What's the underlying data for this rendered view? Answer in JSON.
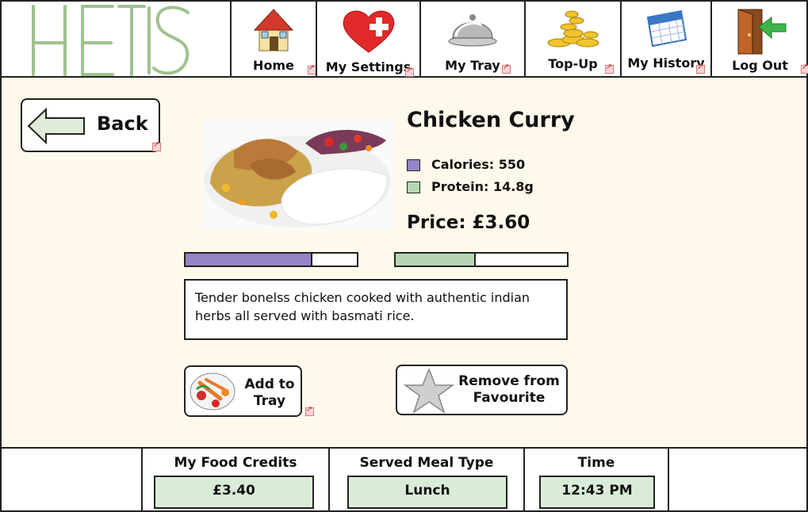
{
  "header": {
    "logo_text": "HEIS",
    "nav": [
      {
        "label": "Home",
        "icon": "house-icon"
      },
      {
        "label": "My Settings",
        "icon": "heart-cross-icon"
      },
      {
        "label": "My Tray",
        "icon": "cloche-icon"
      },
      {
        "label": "Top-Up",
        "icon": "coins-icon"
      },
      {
        "label": "My History",
        "icon": "calendar-icon"
      },
      {
        "label": "Log Out",
        "icon": "door-exit-icon"
      }
    ]
  },
  "main": {
    "back_label": "Back",
    "dish": {
      "title": "Chicken Curry",
      "calories_label": "Calories: 550",
      "protein_label": "Protein: 14.8g",
      "price_label": "Price: £3.60",
      "calories_fraction": 0.73,
      "protein_fraction": 0.46,
      "description": "Tender bonelss chicken cooked with authentic indian herbs all served with basmati rice."
    },
    "add_button": "Add to Tray",
    "favourite_button": "Remove from Favourite",
    "colors": {
      "calories": "#9584c8",
      "protein": "#b5d6b0",
      "background": "#fef9ea"
    }
  },
  "footer": {
    "credits_label": "My Food Credits",
    "credits_value": "£3.40",
    "meal_label": "Served Meal Type",
    "meal_value": "Lunch",
    "time_label": "Time",
    "time_value": "12:43 PM"
  }
}
